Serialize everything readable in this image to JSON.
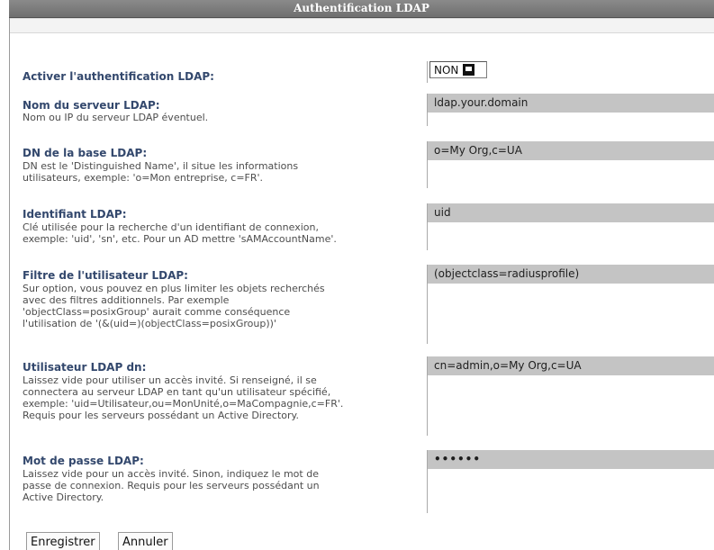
{
  "header": {
    "title": "Authentification LDAP"
  },
  "fields": {
    "enable": {
      "label": "Activer l'authentification LDAP:",
      "value": "NON"
    },
    "server": {
      "label": "Nom du serveur LDAP:",
      "help": [
        "Nom ou IP du serveur LDAP éventuel."
      ],
      "value": "ldap.your.domain"
    },
    "basedn": {
      "label": "DN de la base LDAP:",
      "help": [
        "DN est le 'Distinguished Name', il situe les informations",
        "utilisateurs, exemple: 'o=Mon entreprise, c=FR'."
      ],
      "value": "o=My Org,c=UA"
    },
    "identifier": {
      "label": "Identifiant LDAP:",
      "help": [
        "Clé utilisée pour la recherche d'un identifiant de connexion,",
        "exemple: 'uid', 'sn', etc. Pour un AD mettre 'sAMAccountName'."
      ],
      "value": "uid"
    },
    "filter": {
      "label": "Filtre de l'utilisateur LDAP:",
      "help": [
        "Sur option, vous pouvez en plus limiter les objets recherchés",
        "avec des filtres additionnels. Par exemple",
        "'objectClass=posixGroup' aurait comme conséquence",
        "l'utilisation de '(&(uid=)(objectClass=posixGroup))'"
      ],
      "value": "(objectclass=radiusprofile)"
    },
    "binddn": {
      "label": "Utilisateur LDAP dn:",
      "help": [
        "Laissez vide pour utiliser un accès invité. Si renseigné, il se",
        "connectera au serveur LDAP en tant qu'un utilisateur spécifié,",
        "exemple: 'uid=Utilisateur,ou=MonUnité,o=MaCompagnie,c=FR'.",
        "Requis pour les serveurs possédant un Active Directory."
      ],
      "value": "cn=admin,o=My Org,c=UA"
    },
    "password": {
      "label": "Mot de passe LDAP:",
      "help": [
        "Laissez vide pour un accès invité. Sinon, indiquez le mot de",
        "passe de connexion. Requis pour les serveurs possédant un",
        "Active Directory."
      ],
      "value": "••••••"
    }
  },
  "buttons": {
    "save": "Enregistrer",
    "cancel": "Annuler"
  }
}
